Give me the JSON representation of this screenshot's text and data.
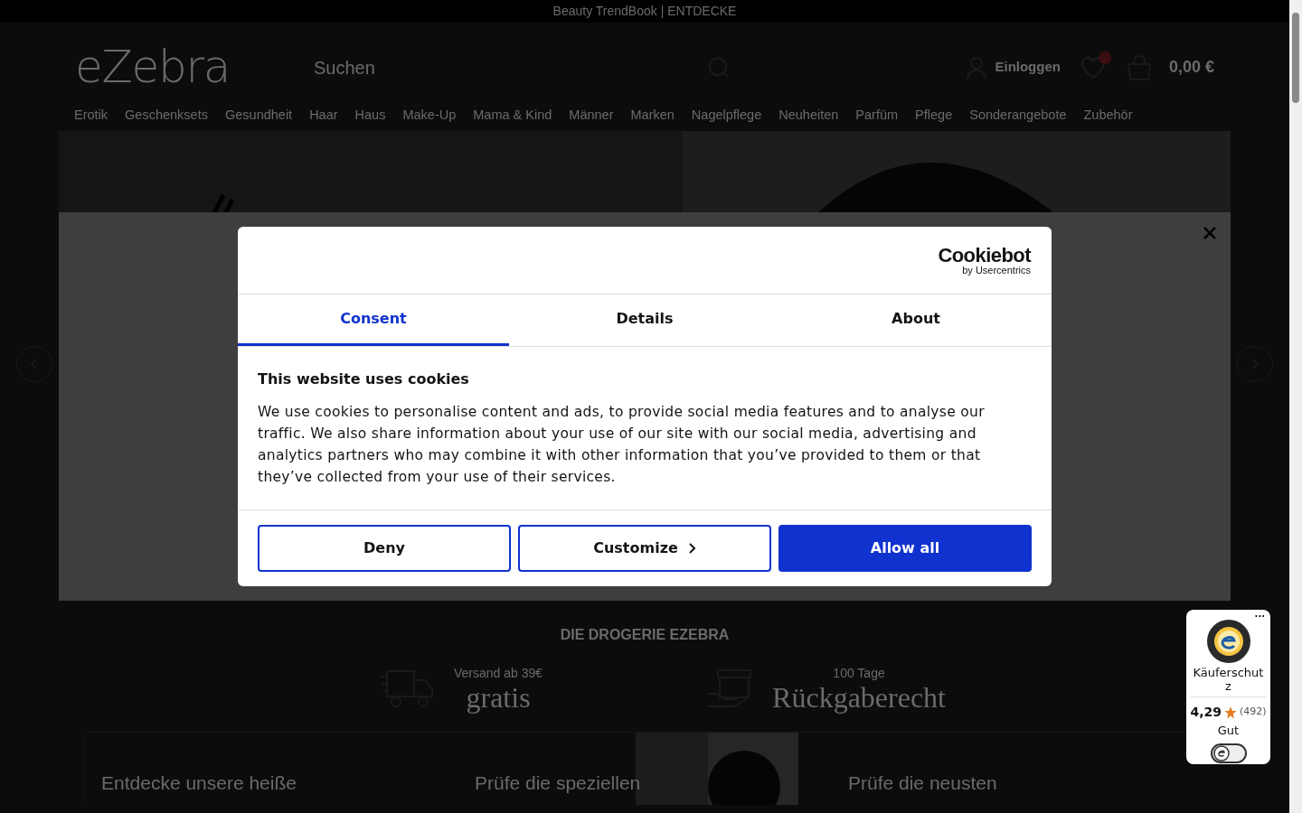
{
  "promo_bar": {
    "text": "Beauty TrendBook | ENTDECKE"
  },
  "header": {
    "logo": "eZebra",
    "search": {
      "placeholder": "Suchen"
    },
    "login": "Einloggen",
    "cart_total": "0,00 €"
  },
  "nav": [
    "Erotik",
    "Geschenksets",
    "Gesundheit",
    "Haar",
    "Haus",
    "Make-Up",
    "Mama & Kind",
    "Männer",
    "Marken",
    "Nagelpflege",
    "Neuheiten",
    "Parfüm",
    "Pflege",
    "Sonderangebote",
    "Zubehör"
  ],
  "section_title": "DIE DROGERIE EZEBRA",
  "benefits": [
    {
      "kind": "shipping",
      "small": "Versand ab 39€",
      "big": "gratis"
    },
    {
      "kind": "returns",
      "small": "100 Tage",
      "big": "Rückgaberecht"
    }
  ],
  "cards": [
    "Entdecke unsere heiße",
    "Prüfe die speziellen",
    "Prüfe die neusten"
  ],
  "cookie_dialog": {
    "brand": "Cookiebot",
    "brand_sub": "by Usercentrics",
    "tabs": [
      {
        "label": "Consent",
        "selected": true
      },
      {
        "label": "Details",
        "selected": false
      },
      {
        "label": "About",
        "selected": false
      }
    ],
    "heading": "This website uses cookies",
    "body": "We use cookies to personalise content and ads, to provide social media features and to analyse our traffic. We also share information about your use of our site with our social media, advertising and analytics partners who may combine it with other information that you’ve provided to them or that they’ve collected from your use of their services.",
    "buttons": [
      {
        "label": "Deny",
        "kind": "outline"
      },
      {
        "label": "Customize",
        "kind": "chevron"
      },
      {
        "label": "Allow all",
        "kind": "primary"
      }
    ]
  },
  "trust_badge": {
    "more": "...",
    "title": "Käuferschutz",
    "rating": "4,29",
    "count": "(492)",
    "grade": "Gut",
    "stars": 1
  }
}
